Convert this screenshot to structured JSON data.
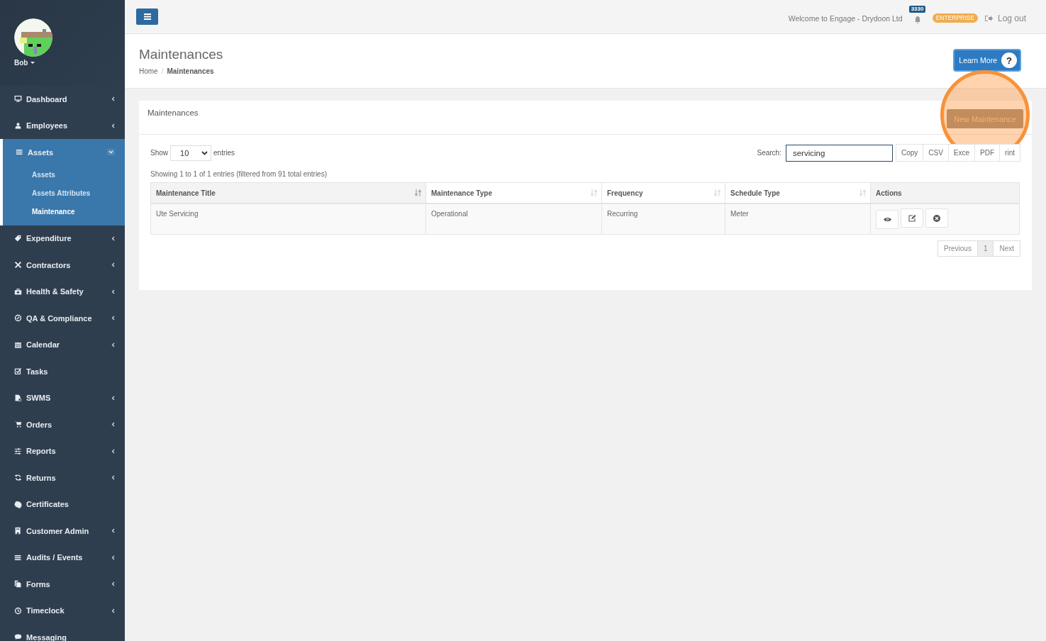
{
  "user": {
    "name": "Bob"
  },
  "sidebar": {
    "items": [
      {
        "label": "Dashboard",
        "expandable": true,
        "expanded": false,
        "selected": false
      },
      {
        "label": "Employees",
        "expandable": true,
        "expanded": false,
        "selected": false
      },
      {
        "label": "Assets",
        "expandable": true,
        "expanded": true,
        "selected": true,
        "children": [
          {
            "label": "Assets",
            "selected": false
          },
          {
            "label": "Assets Attributes",
            "selected": false
          },
          {
            "label": "Maintenance",
            "selected": true
          }
        ]
      },
      {
        "label": "Expenditure",
        "expandable": true,
        "expanded": false,
        "selected": false
      },
      {
        "label": "Contractors",
        "expandable": true,
        "expanded": false,
        "selected": false
      },
      {
        "label": "Health & Safety",
        "expandable": true,
        "expanded": false,
        "selected": false
      },
      {
        "label": "QA & Compliance",
        "expandable": true,
        "expanded": false,
        "selected": false
      },
      {
        "label": "Calendar",
        "expandable": true,
        "expanded": false,
        "selected": false
      },
      {
        "label": "Tasks",
        "expandable": false,
        "selected": false
      },
      {
        "label": "SWMS",
        "expandable": true,
        "expanded": false,
        "selected": false
      },
      {
        "label": "Orders",
        "expandable": true,
        "expanded": false,
        "selected": false
      },
      {
        "label": "Reports",
        "expandable": true,
        "expanded": false,
        "selected": false
      },
      {
        "label": "Returns",
        "expandable": true,
        "expanded": false,
        "selected": false
      },
      {
        "label": "Certificates",
        "expandable": false,
        "selected": false
      },
      {
        "label": "Customer Admin",
        "expandable": true,
        "expanded": false,
        "selected": false
      },
      {
        "label": "Audits / Events",
        "expandable": true,
        "expanded": false,
        "selected": false
      },
      {
        "label": "Forms",
        "expandable": true,
        "expanded": false,
        "selected": false
      },
      {
        "label": "Timeclock",
        "expandable": true,
        "expanded": false,
        "selected": false
      },
      {
        "label": "Messaging",
        "expandable": false,
        "selected": false
      }
    ]
  },
  "topbar": {
    "welcome": "Welcome to Engage - Drydoon Ltd",
    "notification_count": "3330",
    "plan_badge": "ENTERPRISE",
    "logout": "Log out"
  },
  "page": {
    "title": "Maintenances",
    "breadcrumb_separator": "/",
    "breadcrumb": [
      {
        "label": "Home",
        "selected": false
      },
      {
        "label": "Maintenances",
        "selected": true
      }
    ],
    "learn_more": "Learn More",
    "help": "?"
  },
  "panel": {
    "title": "Maintenances",
    "new_button": {
      "label": "New Maintenance",
      "highlighted": true
    },
    "length": {
      "before": "Show",
      "value": "10",
      "after": "entries"
    },
    "search": {
      "label": "Search:",
      "value": "servicing"
    },
    "export_buttons": [
      "Copy",
      "CSV",
      "Exce",
      "PDF",
      "rint"
    ],
    "info": "Showing 1 to 1 of 1 entries (filtered from 91 total entries)",
    "table": {
      "columns": [
        {
          "label": "Maintenance Title",
          "sortable": true,
          "sorted": true
        },
        {
          "label": "Maintenance Type",
          "sortable": true,
          "sorted": false
        },
        {
          "label": "Frequency",
          "sortable": true,
          "sorted": false
        },
        {
          "label": "Schedule Type",
          "sortable": true,
          "sorted": false
        },
        {
          "label": "Actions",
          "sortable": false,
          "sorted": false
        }
      ],
      "rows": [
        {
          "cells": [
            "Ute Servicing",
            "Operational",
            "Recurring",
            "Meter"
          ]
        }
      ]
    },
    "pagination": [
      {
        "label": "Previous",
        "selected": false
      },
      {
        "label": "1",
        "selected": true
      },
      {
        "label": "Next",
        "selected": false
      }
    ]
  }
}
